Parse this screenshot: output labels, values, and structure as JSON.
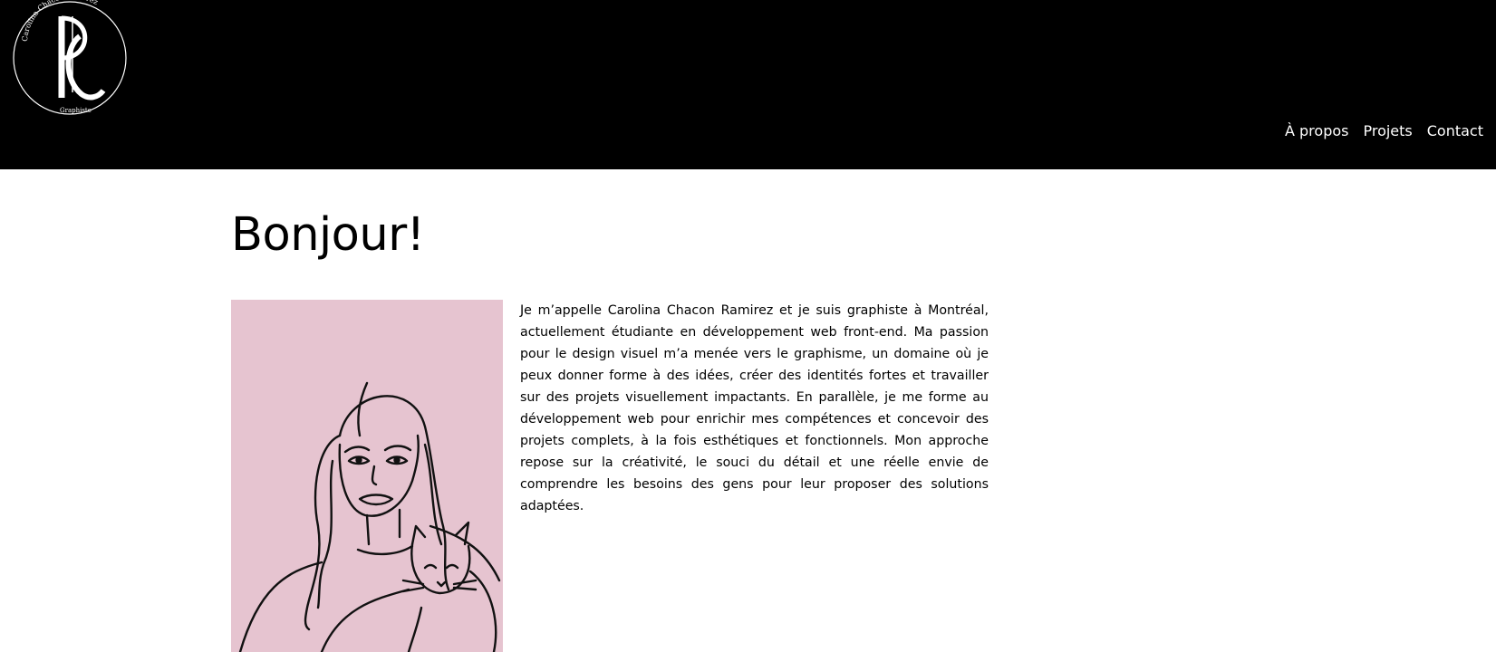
{
  "header": {
    "logo": {
      "monogram": "CR",
      "name_text": "Carolina Chacon Ramirez",
      "subtitle_text": "Graphiste"
    }
  },
  "nav": {
    "items": [
      "À propos",
      "Projets",
      "Contact"
    ]
  },
  "main": {
    "title": "Bonjour!",
    "bio": "Je m’appelle Carolina Chacon Ramirez et je suis graphiste à Montréal, actuellement étudiante en développement web front-end. Ma passion pour le design visuel m’a menée vers le graphisme, un domaine où je peux donner forme à des idées, créer des identités fortes et travailler sur des projets visuellement impactants. En parallèle, je me forme au développement web pour enrichir mes compétences et concevoir des projets complets, à la fois esthétiques et fonctionnels. Mon approche repose sur la créativité, le souci du détail et une réelle envie de comprendre les besoins des gens pour leur proposer des solutions adaptées."
  },
  "colors": {
    "header_bg": "#000000",
    "page_bg": "#ffffff",
    "portrait_bg": "#e6c4d0",
    "nav_text": "#ffffff"
  }
}
